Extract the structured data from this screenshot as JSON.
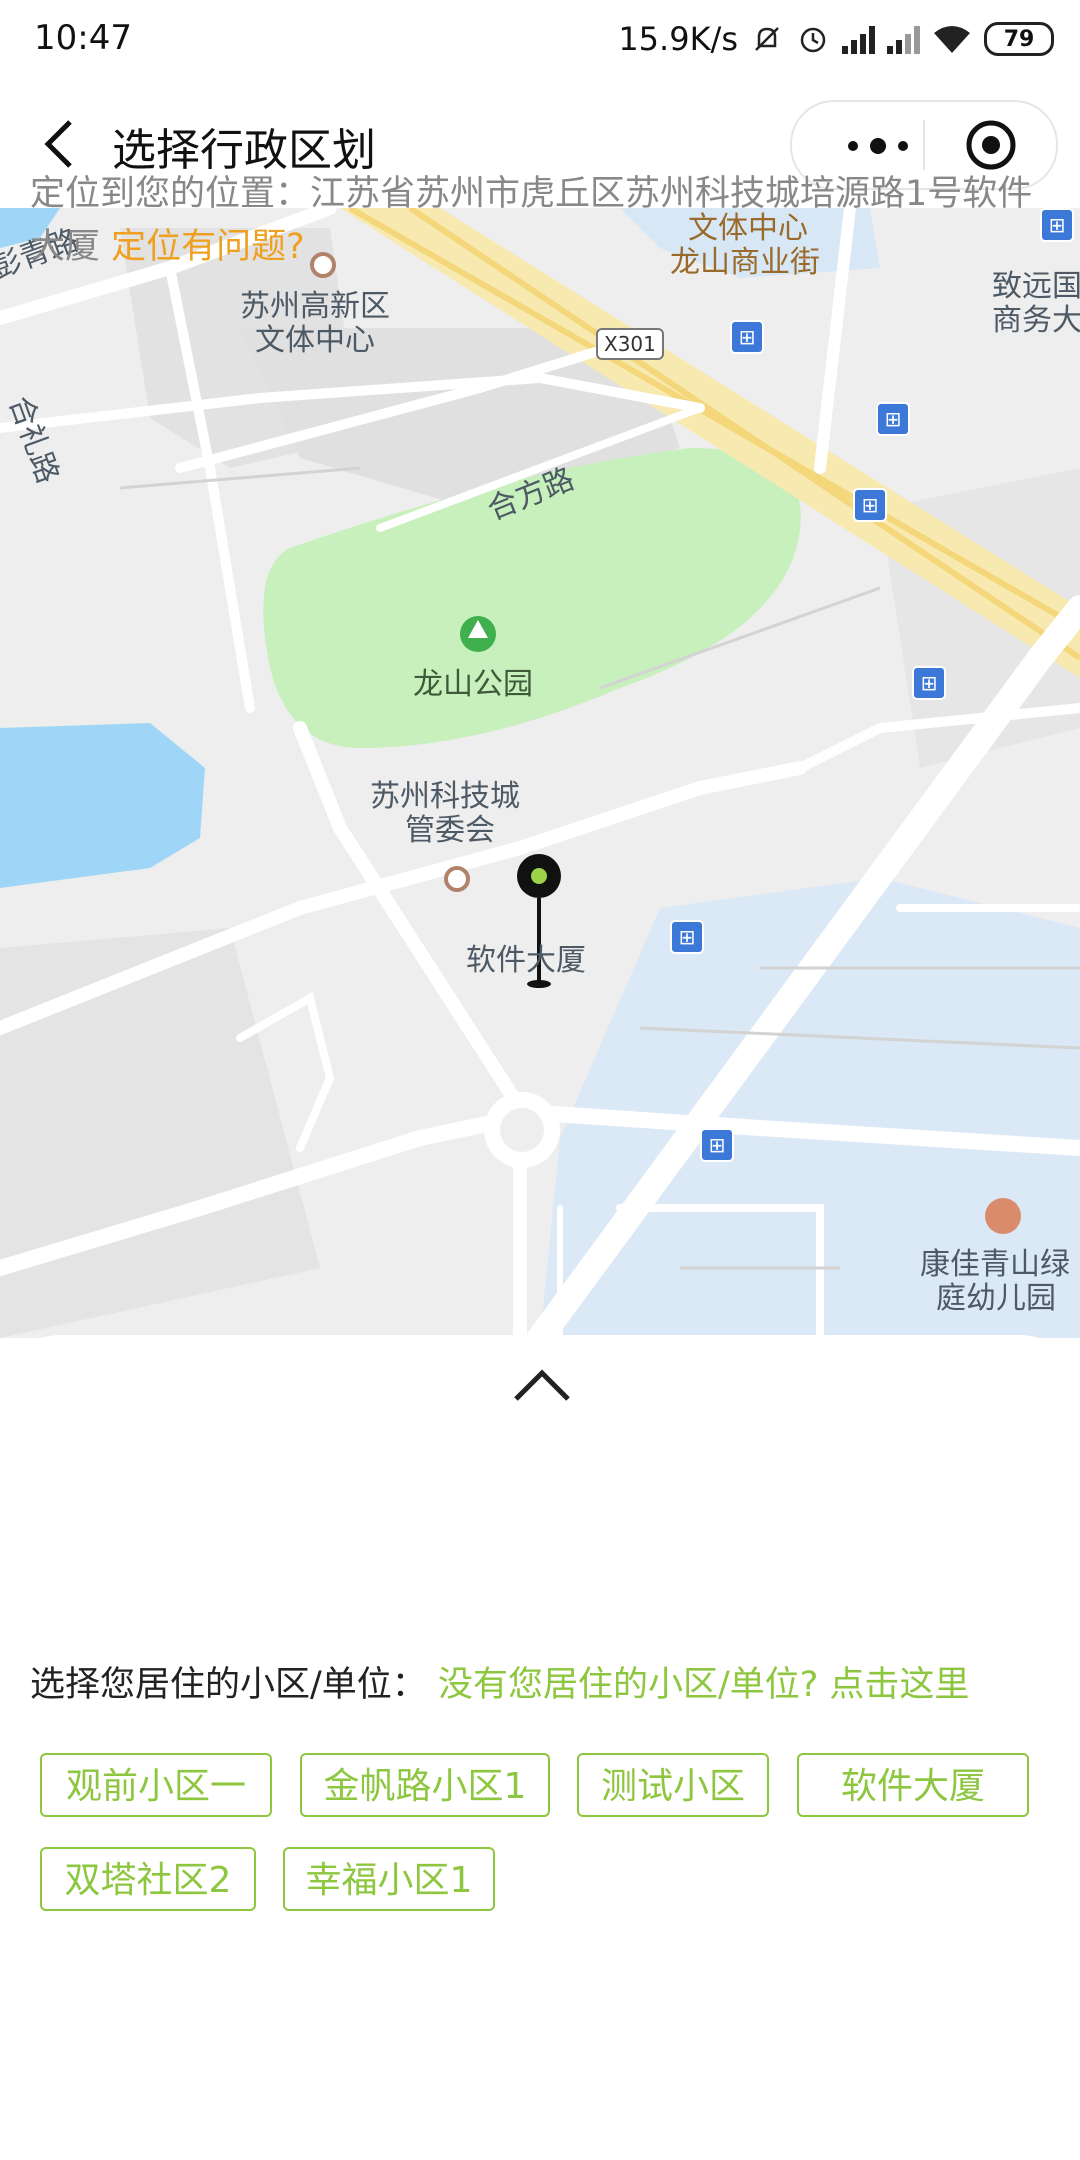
{
  "status_bar": {
    "time": "10:47",
    "net_speed": "15.9K/s",
    "battery": "79",
    "icons": [
      "mute-bell-icon",
      "alarm-icon",
      "hd-signal-icon",
      "signal-icon",
      "wifi-icon",
      "battery-icon"
    ]
  },
  "header": {
    "title": "选择行政区划",
    "back_icon": "back-arrow-icon",
    "more_icon": "more-dots-icon",
    "close_icon": "target-circle-icon"
  },
  "map": {
    "labels": {
      "wenti_top": "文体中心",
      "longshan_street": "龙山商业街",
      "zhiyuan1": "致远国",
      "zhiyuan2": "商务大",
      "gaoxin1": "苏州高新区",
      "gaoxin2": "文体中心",
      "road_left_top": "彭青路",
      "heli_road": "合礼路",
      "hefang_road": "合方路",
      "x301": "X301",
      "longshan_park": "龙山公园",
      "kejicheng1": "苏州科技城",
      "kejicheng2": "管委会",
      "software_building": "软件大厦",
      "kangjia1": "康佳青山绿",
      "kangjia2": "庭幼儿园"
    }
  },
  "sheet": {
    "collapse_icon": "chevron-up-icon",
    "location_prefix": "定位到您的位置：江苏省苏州市虎丘区苏州科技城培源路1号软件大厦",
    "location_problem": "定位有问题?",
    "choose_label": "选择您居住的小区/单位：",
    "choose_link": "没有您居住的小区/单位? 点击这里",
    "communities": [
      "观前小区一",
      "金帆路小区1",
      "测试小区",
      "软件大厦",
      "双塔社区2",
      "幸福小区1"
    ]
  },
  "colors": {
    "accent_green": "#8dc63f",
    "warning_orange": "#f0a020",
    "park_green": "#c8f0bc",
    "water_blue": "#9fd6f7"
  }
}
